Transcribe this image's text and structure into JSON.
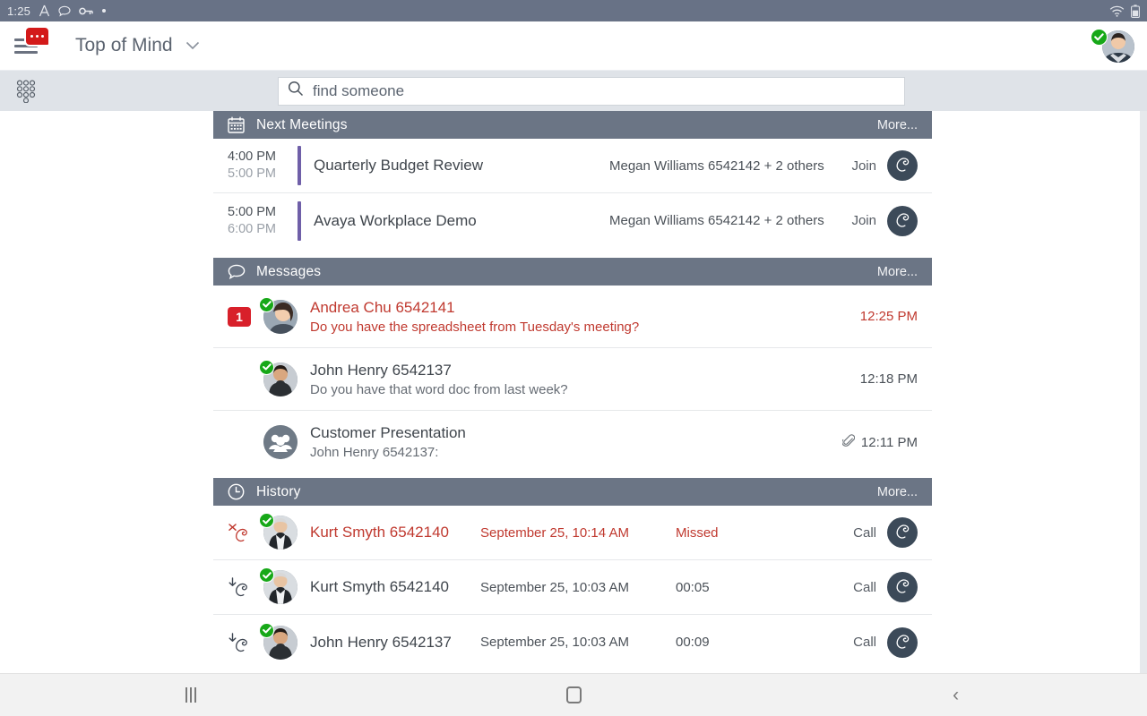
{
  "statusbar": {
    "time": "1:25",
    "icons": [
      "a-glyph-icon",
      "chat-bubble-icon",
      "key-icon",
      "dot-icon"
    ],
    "right_icons": [
      "wifi-icon",
      "battery-icon"
    ]
  },
  "appbar": {
    "menu_icon": "hamburger-menu-icon",
    "menu_badge_icon": "messages-badge-icon",
    "title": "Top of Mind",
    "chevron": "⌄",
    "avatar_name": "user-avatar",
    "presence": "available"
  },
  "search": {
    "dialpad_icon": "dialpad-icon",
    "search_icon": "search-icon",
    "placeholder": "find someone",
    "value": ""
  },
  "sections": {
    "meetings": {
      "icon": "calendar-icon",
      "title": "Next Meetings",
      "more_label": "More...",
      "rows": [
        {
          "start": "4:00 PM",
          "end": "5:00 PM",
          "subject": "Quarterly Budget Review",
          "participants": "Megan Williams 6542142 + 2 others",
          "action_label": "Join",
          "action_icon": "phone-handset-icon"
        },
        {
          "start": "5:00 PM",
          "end": "6:00 PM",
          "subject": "Avaya Workplace Demo",
          "participants": "Megan Williams 6542142 + 2 others",
          "action_label": "Join",
          "action_icon": "phone-handset-icon"
        }
      ]
    },
    "messages": {
      "icon": "speech-bubble-icon",
      "title": "Messages",
      "more_label": "More...",
      "rows": [
        {
          "unread_count": "1",
          "avatar": "contact-photo-andrea",
          "presence": "available",
          "name": "Andrea Chu 6542141",
          "preview": "Do you have the spreadsheet from Tuesday's meeting?",
          "time": "12:25 PM",
          "attachment": false,
          "unread": true
        },
        {
          "unread_count": "",
          "avatar": "contact-photo-john",
          "presence": "available",
          "name": "John Henry 6542137",
          "preview": "Do you have that word doc from last week?",
          "time": "12:18 PM",
          "attachment": false,
          "unread": false
        },
        {
          "unread_count": "",
          "avatar": "group-avatar-icon",
          "presence": "none",
          "name": "Customer Presentation",
          "preview": "John Henry 6542137:",
          "time": "12:11 PM",
          "attachment": true,
          "attachment_icon": "paperclip-icon",
          "unread": false
        }
      ]
    },
    "history": {
      "icon": "clock-icon",
      "title": "History",
      "more_label": "More...",
      "rows": [
        {
          "direction_icon": "missed-call-icon",
          "avatar": "contact-photo-kurt",
          "presence": "available",
          "name": "Kurt Smyth 6542140",
          "date": "September 25, 10:14 AM",
          "duration": "Missed",
          "action_label": "Call",
          "action_icon": "phone-handset-icon",
          "missed": true
        },
        {
          "direction_icon": "incoming-call-icon",
          "avatar": "contact-photo-kurt",
          "presence": "available",
          "name": "Kurt Smyth 6542140",
          "date": "September 25, 10:03 AM",
          "duration": "00:05",
          "action_label": "Call",
          "action_icon": "phone-handset-icon",
          "missed": false
        },
        {
          "direction_icon": "incoming-call-icon",
          "avatar": "contact-photo-john",
          "presence": "available",
          "name": "John Henry 6542137",
          "date": "September 25, 10:03 AM",
          "duration": "00:09",
          "action_label": "Call",
          "action_icon": "phone-handset-icon",
          "missed": false
        }
      ]
    }
  },
  "navbar": {
    "recents_icon": "recents-icon",
    "home_icon": "home-icon",
    "back_icon": "back-icon",
    "back_glyph": "‹"
  },
  "colors": {
    "status_bar": "#687286",
    "section_header": "#6b7585",
    "accent_red": "#d8202a",
    "missed_red": "#c0392f",
    "presence_green": "#17a818",
    "meeting_bar": "#6f5fa8",
    "call_button": "#3c4a59",
    "search_row": "#dfe3e8"
  }
}
